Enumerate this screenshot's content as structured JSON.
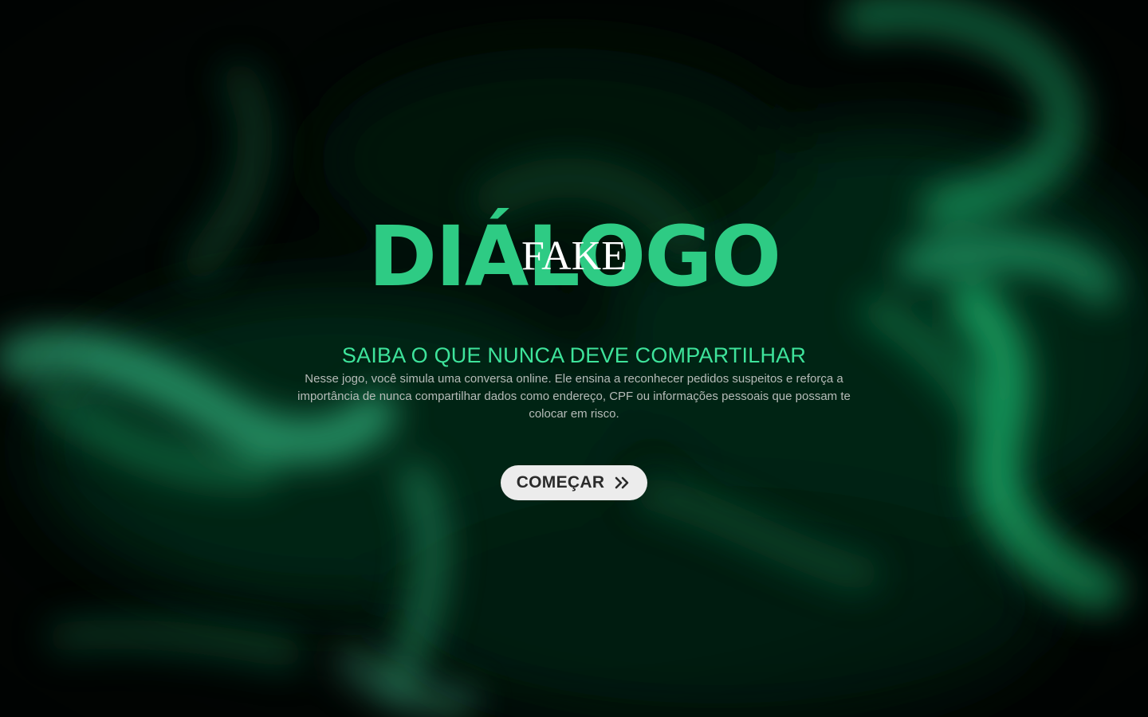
{
  "hero": {
    "title": "DIÁLOGO",
    "title_overlay": "FAKE",
    "subtitle": "SAIBA O QUE NUNCA DEVE COMPARTILHAR",
    "description": "Nesse jogo, você simula uma conversa online. Ele ensina a reconhecer pedidos suspeitos e reforça a importância de nunca compartilhar dados como endereço, CPF ou informações pessoais que possam te colocar em risco.",
    "start_button_label": "COMEÇAR",
    "start_button_icon": "double-chevron-right-icon"
  },
  "colors": {
    "background": "#010604",
    "accent_green": "#2ecb84",
    "subtitle_green": "#3ee39b",
    "description_text": "#b6bbb8",
    "button_bg": "#ececec",
    "button_text": "#2b2b2b",
    "overlay_text": "#ffffff"
  }
}
